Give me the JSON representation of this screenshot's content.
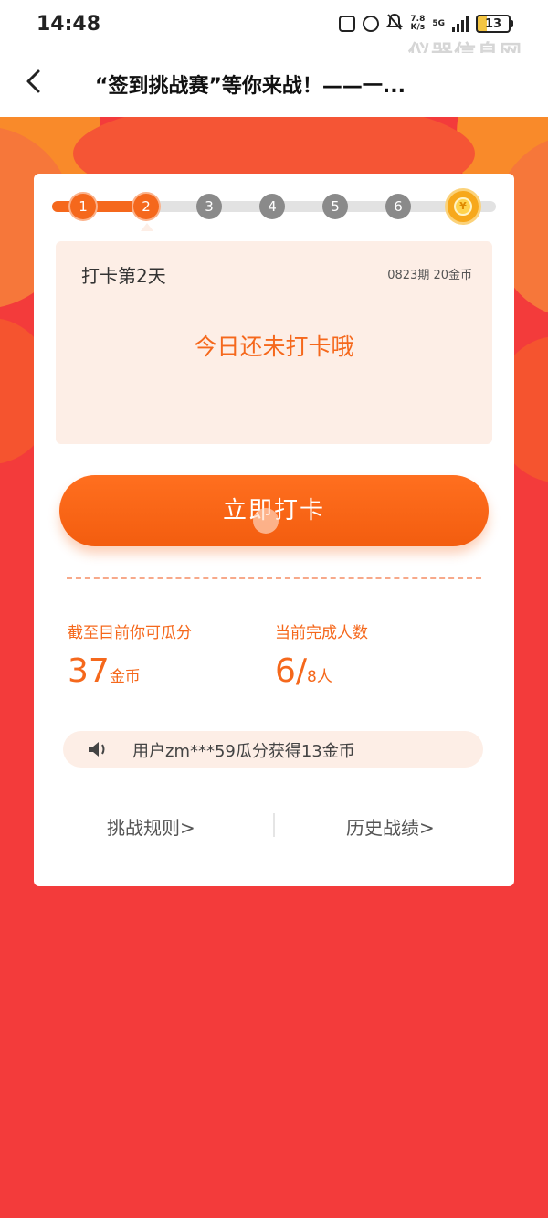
{
  "status_bar": {
    "time": "14:48",
    "speed_value": "7.8",
    "speed_unit": "K/s",
    "network": "5G",
    "battery": "13"
  },
  "watermark": "仪器信息网",
  "nav": {
    "title": "“签到挑战赛”等你来战！——一..."
  },
  "progress": {
    "steps": [
      "1",
      "2",
      "3",
      "4",
      "5",
      "6"
    ],
    "completed": 2,
    "reward_icon": "coin-icon"
  },
  "checkin": {
    "day_label": "打卡第2天",
    "meta": "0823期 20金币",
    "status": "今日还未打卡哦",
    "button_label": "立即打卡"
  },
  "stats": {
    "share_label": "截至目前你可瓜分",
    "share_value": "37",
    "share_unit": "金币",
    "complete_label": "当前完成人数",
    "complete_value": "6/",
    "complete_total": "8人"
  },
  "ticker": {
    "text": "用户zm***59瓜分获得13金币"
  },
  "footer": {
    "rules_label": "挑战规则>",
    "history_label": "历史战绩>"
  },
  "colors": {
    "accent": "#f5681c",
    "background": "#f33b3b",
    "panel": "#fdeee6"
  }
}
